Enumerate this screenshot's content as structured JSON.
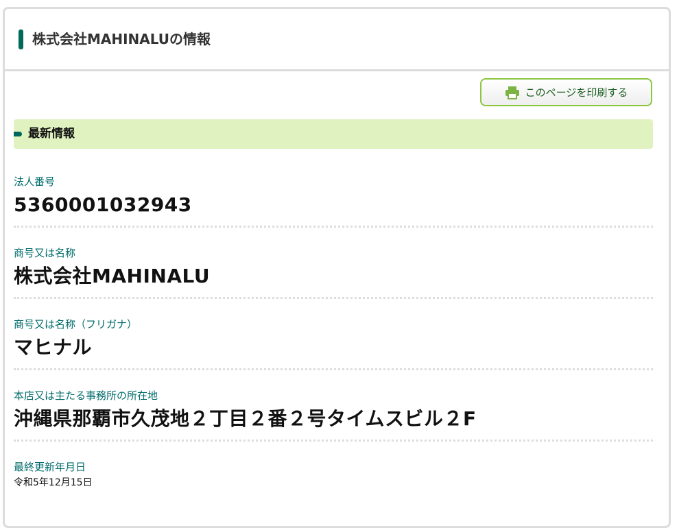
{
  "header": {
    "title": "株式会社MAHINALUの情報"
  },
  "toolbar": {
    "print_label": "このページを印刷する"
  },
  "section": {
    "title": "最新情報"
  },
  "fields": [
    {
      "label": "法人番号",
      "value": "5360001032943"
    },
    {
      "label": "商号又は名称",
      "value": "株式会社MAHINALU"
    },
    {
      "label": "商号又は名称（フリガナ）",
      "value": "マヒナル"
    },
    {
      "label": "本店又は主たる事務所の所在地",
      "value": "沖縄県那覇市久茂地２丁目２番２号タイムスビル２F"
    },
    {
      "label": "最終更新年月日",
      "value": "令和5年12月15日"
    }
  ],
  "colors": {
    "accent": "#00695c",
    "section_bg": "#dff2bf",
    "button_border": "#8cc63f",
    "label_text": "#006b6b"
  },
  "icons": {
    "print": "printer-icon"
  }
}
